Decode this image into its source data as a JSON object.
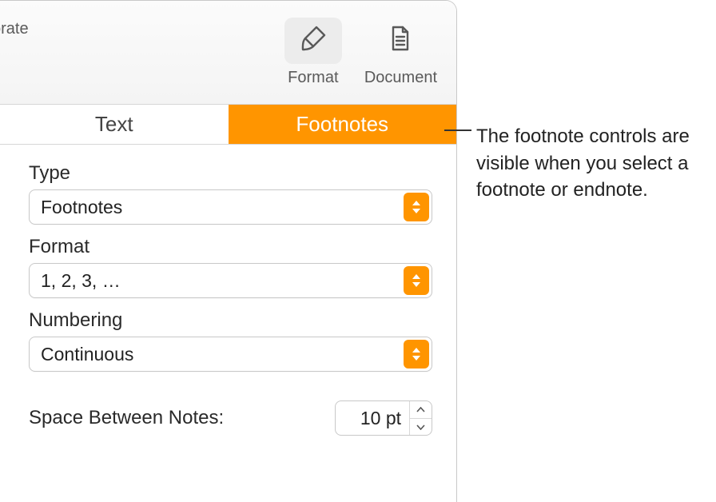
{
  "toolbar": {
    "left_partial_label": "orate",
    "format_label": "Format",
    "document_label": "Document"
  },
  "tabs": {
    "text_label": "Text",
    "footnotes_label": "Footnotes"
  },
  "fields": {
    "type_label": "Type",
    "type_value": "Footnotes",
    "format_label": "Format",
    "format_value": "1, 2, 3, …",
    "numbering_label": "Numbering",
    "numbering_value": "Continuous",
    "space_label": "Space Between Notes:",
    "space_value": "10 pt"
  },
  "callout": {
    "text": "The footnote controls are visible when you select a footnote or endnote."
  }
}
